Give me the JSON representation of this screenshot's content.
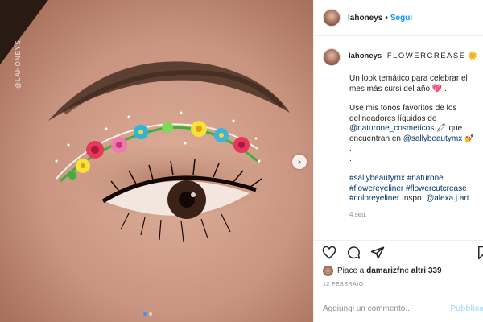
{
  "post": {
    "username": "lahoneys",
    "separator": "•",
    "follow_label": "Segui",
    "watermark": "@LAHONEYS"
  },
  "caption": {
    "username": "lahoneys",
    "title": "FLOWERCREASE",
    "title_emoji": "🌼",
    "line1": "Un look temático para celebrar el mes más cursi del año 💖 .",
    "line2a": "Use mis tonos favoritos de los delineadores líquidos de ",
    "mention1": "@naturone_cosmeticos",
    "line2b": " 🖍 que encuentran en ",
    "mention2": "@sallybeautymx",
    "line2c": " 💅",
    "dot1": ".",
    "dot2": ".",
    "tag1": "#sallybeautymx",
    "tag2": "#naturone",
    "tag3": "#flowereyeliner",
    "tag4": "#flowercutcrease",
    "tag5": "#coloreyeliner",
    "inspo_label": "Inspo: ",
    "mention3": "@alexa.j.art",
    "time_ago": "4 sett."
  },
  "likes": {
    "prefix": "Piace a ",
    "user": "damarizfn",
    "middle": " e ",
    "others": "altri 339"
  },
  "date": "12 FEBBRAIO",
  "comment": {
    "placeholder": "Aggiungi un commento...",
    "publish_label": "Pubblica"
  },
  "icons": [
    "heart-icon",
    "comment-icon",
    "share-icon",
    "bookmark-icon",
    "chevron-right-icon"
  ],
  "colors": {
    "accent": "#0095f6",
    "publish_disabled": "#b2dffc",
    "link": "#00376b"
  }
}
